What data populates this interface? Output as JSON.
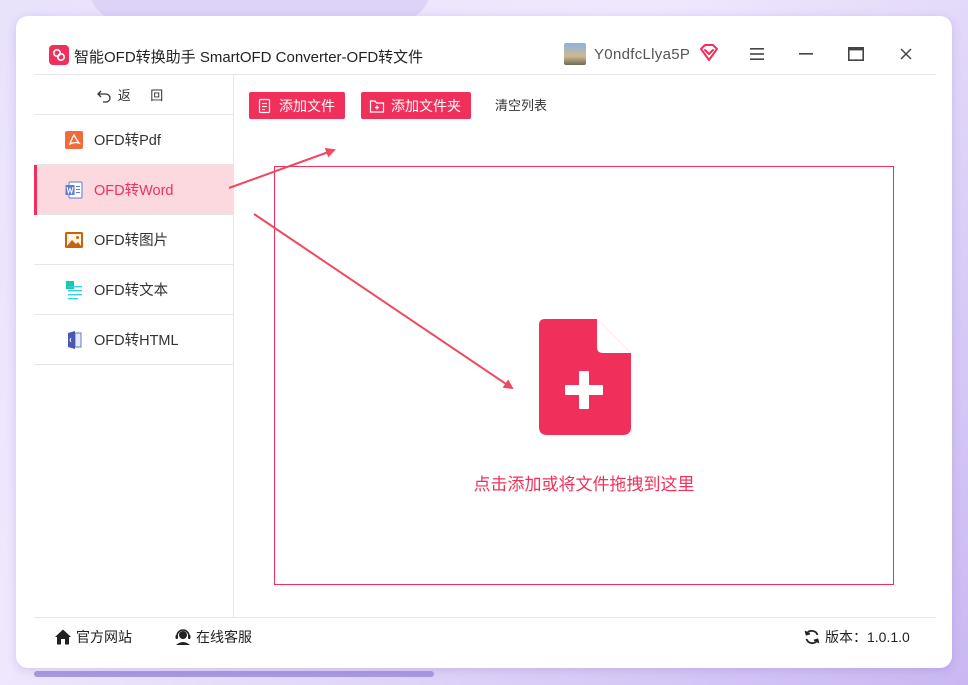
{
  "app": {
    "title": "智能OFD转换助手 SmartOFD Converter-OFD转文件",
    "username": "Y0ndfcLlya5P",
    "accent_color": "#f0305b"
  },
  "window_controls": {
    "menu_icon": "hamburger-icon",
    "minimize_icon": "minimize-icon",
    "maximize_icon": "maximize-icon",
    "close_icon": "close-icon"
  },
  "sidebar": {
    "back_label": "返 回",
    "items": [
      {
        "label": "OFD转Pdf",
        "icon": "pdf-icon",
        "active": false
      },
      {
        "label": "OFD转Word",
        "icon": "word-icon",
        "active": true
      },
      {
        "label": "OFD转图片",
        "icon": "image-icon",
        "active": false
      },
      {
        "label": "OFD转文本",
        "icon": "text-icon",
        "active": false
      },
      {
        "label": "OFD转HTML",
        "icon": "html-icon",
        "active": false
      }
    ]
  },
  "toolbar": {
    "add_file": "添加文件",
    "add_folder": "添加文件夹",
    "clear_list": "清空列表"
  },
  "dropzone": {
    "hint": "点击添加或将文件拖拽到这里",
    "icon": "file-add-icon"
  },
  "footer": {
    "website": "官方网站",
    "support": "在线客服",
    "version_label": "版本：1.0.1.0"
  }
}
